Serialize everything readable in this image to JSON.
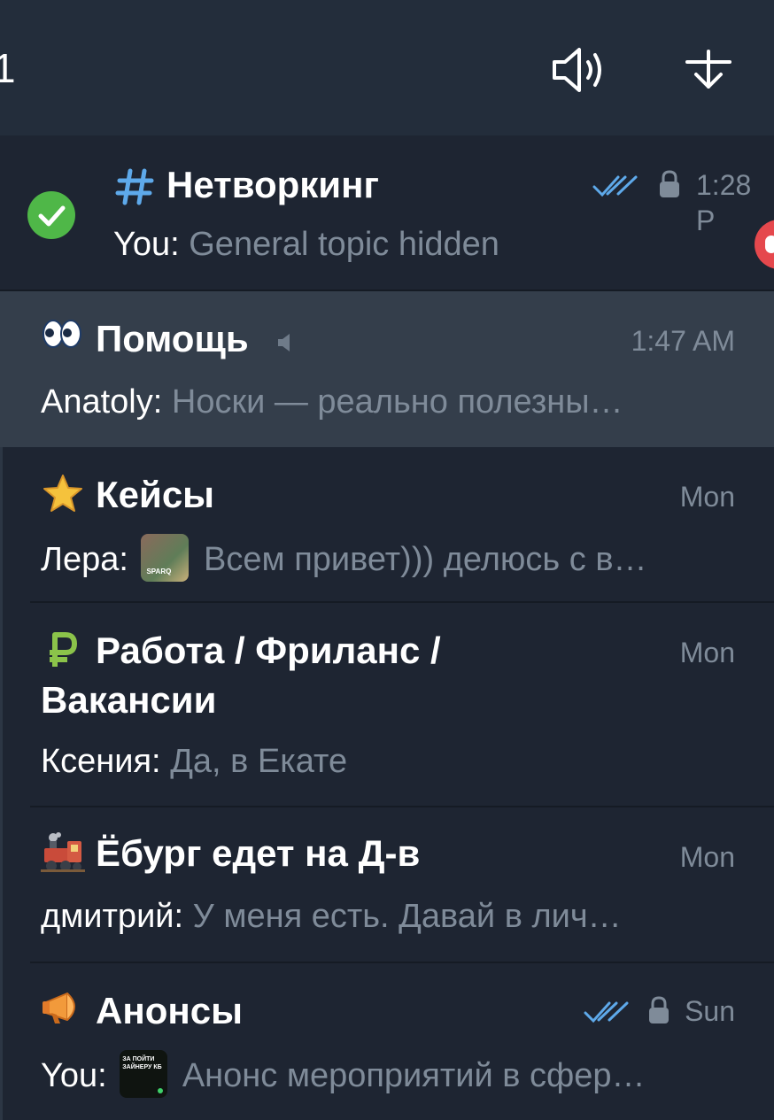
{
  "header": {
    "number_fragment": "1",
    "icons": [
      "speaker-icon",
      "download-arrow-icon"
    ]
  },
  "colors": {
    "background": "#1e2532",
    "header": "#232d3b",
    "selected_row": "#343e4b",
    "accent_blue": "#5ea9ea",
    "muted_text": "#7f8b99",
    "online_green": "#4fb748",
    "unread_red": "#e5484d"
  },
  "chats": [
    {
      "icon": "hash-icon",
      "title": "Нетворкинг",
      "sender": "You:",
      "snippet": "General topic hidden",
      "time": "1:28 P",
      "read": true,
      "locked": true
    },
    {
      "icon": "eyes-icon",
      "title": "Помощь",
      "muted": true,
      "sender": "Anatoly:",
      "snippet": "Носки — реально полезны…",
      "time": "1:47 AM"
    },
    {
      "icon": "star-icon",
      "title": "Кейсы",
      "sender": "Лера:",
      "thumb_text": "SPARQ",
      "snippet": "Всем привет))) делюсь с в…",
      "time": "Mon"
    },
    {
      "icon": "ruble-icon",
      "title": "Работа / Фриланс / Вакансии",
      "sender": "Ксения:",
      "snippet": "Да, в Екате",
      "time": "Mon"
    },
    {
      "icon": "locomotive-icon",
      "title": "Ёбург едет на Д-в",
      "sender": "дмитрий:",
      "snippet": "У меня есть. Давай в лич…",
      "time": "Mon"
    },
    {
      "icon": "megaphone-icon",
      "title": "Анонсы",
      "sender": "You:",
      "thumb_text": "ЗА ПОЙТИ ЗАЙНЕРУ КБ",
      "snippet": "Анонс мероприятий в сфер…",
      "time": "Sun",
      "read": true,
      "locked": true
    }
  ]
}
